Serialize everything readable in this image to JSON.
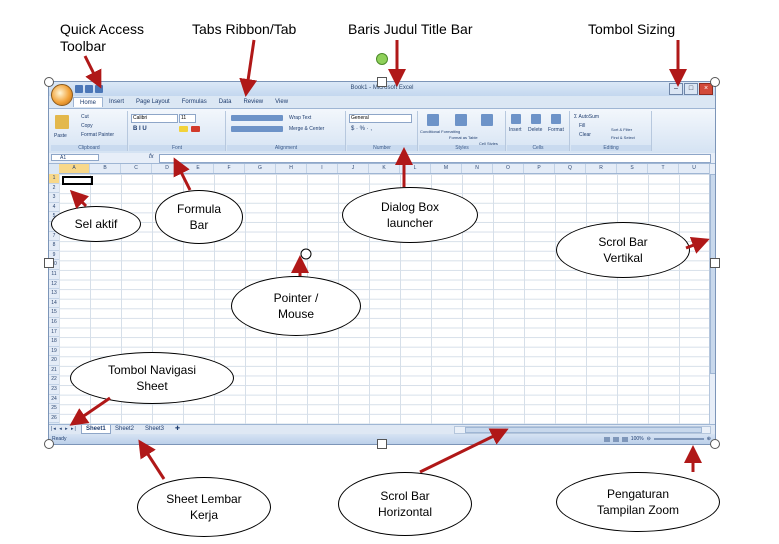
{
  "annotations": {
    "quick_access": [
      "Quick Access",
      "Toolbar"
    ],
    "tabs_ribbon": "Tabs Ribbon/Tab",
    "title_bar": "Baris Judul Title Bar",
    "sizing": "Tombol Sizing",
    "active_cell": "Sel aktif",
    "formula_bar": [
      "Formula",
      "Bar"
    ],
    "dialog_launcher": [
      "Dialog Box",
      "launcher"
    ],
    "scroll_vertical": [
      "Scrol Bar",
      "Vertikal"
    ],
    "pointer": [
      "Pointer /",
      "Mouse"
    ],
    "sheet_nav": [
      "Tombol Navigasi",
      "Sheet"
    ],
    "sheet_work": [
      "Sheet Lembar",
      "Kerja"
    ],
    "scroll_horizontal": [
      "Scrol Bar",
      "Horizontal"
    ],
    "zoom_view": [
      "Pengaturan",
      "Tampilan Zoom"
    ]
  },
  "excel": {
    "title": "Book1 - Microsoft Excel",
    "tabs": [
      "Home",
      "Insert",
      "Page Layout",
      "Formulas",
      "Data",
      "Review",
      "View"
    ],
    "clipboard": {
      "paste": "Paste",
      "cut": "Cut",
      "copy": "Copy",
      "painter": "Format Painter",
      "group": "Clipboard"
    },
    "font": {
      "name": "Calibri",
      "size": "11",
      "group": "Font"
    },
    "alignment": {
      "wrap": "Wrap Text",
      "merge": "Merge & Center",
      "group": "Alignment"
    },
    "number": {
      "format": "General",
      "group": "Number"
    },
    "styles": {
      "conditional": "Conditional Formatting",
      "as_table": "Format as Table",
      "cell_styles": "Cell Styles",
      "group": "Styles"
    },
    "cells": {
      "insert": "Insert",
      "delete": "Delete",
      "format": "Format",
      "group": "Cells"
    },
    "editing": {
      "autosum": "AutoSum",
      "fill": "Fill",
      "clear": "Clear",
      "sort": "Sort & Filter",
      "find": "Find & Select",
      "group": "Editing"
    },
    "name_box": "A1",
    "fx": "fx",
    "columns": [
      "A",
      "B",
      "C",
      "D",
      "E",
      "F",
      "G",
      "H",
      "I",
      "J",
      "K",
      "L",
      "M",
      "N",
      "O",
      "P",
      "Q",
      "R",
      "S",
      "T",
      "U"
    ],
    "rows": [
      "1",
      "2",
      "3",
      "4",
      "5",
      "6",
      "7",
      "8",
      "9",
      "10",
      "11",
      "12",
      "13",
      "14",
      "15",
      "16",
      "17",
      "18",
      "19",
      "20",
      "21",
      "22",
      "23",
      "24",
      "25",
      "26"
    ],
    "sheets": [
      "Sheet1",
      "Sheet2",
      "Sheet3"
    ],
    "sheet_nav": "|◂ ◂ ▸ ▸|",
    "status": "Ready",
    "zoom": "100%"
  }
}
